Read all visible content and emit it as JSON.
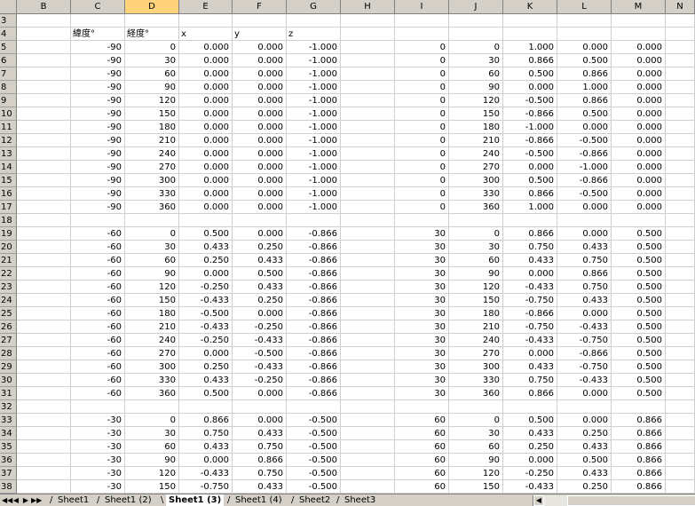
{
  "columns": [
    "B",
    "C",
    "D",
    "E",
    "F",
    "G",
    "H",
    "I",
    "J",
    "K",
    "L",
    "M",
    "N"
  ],
  "selected_column": "D",
  "header_row": {
    "row": "4",
    "c": "緯度°",
    "d": "経度°",
    "e": "x",
    "f": "y",
    "g": "z"
  },
  "rows": [
    {
      "r": "3"
    },
    {
      "r": "4",
      "hdr": true
    },
    {
      "r": "5",
      "c": "-90",
      "d": "0",
      "e": "0.000",
      "f": "0.000",
      "g": "-1.000",
      "i": "0",
      "j": "0",
      "k": "1.000",
      "l": "0.000",
      "m": "0.000"
    },
    {
      "r": "6",
      "c": "-90",
      "d": "30",
      "e": "0.000",
      "f": "0.000",
      "g": "-1.000",
      "i": "0",
      "j": "30",
      "k": "0.866",
      "l": "0.500",
      "m": "0.000"
    },
    {
      "r": "7",
      "c": "-90",
      "d": "60",
      "e": "0.000",
      "f": "0.000",
      "g": "-1.000",
      "i": "0",
      "j": "60",
      "k": "0.500",
      "l": "0.866",
      "m": "0.000"
    },
    {
      "r": "8",
      "c": "-90",
      "d": "90",
      "e": "0.000",
      "f": "0.000",
      "g": "-1.000",
      "i": "0",
      "j": "90",
      "k": "0.000",
      "l": "1.000",
      "m": "0.000"
    },
    {
      "r": "9",
      "c": "-90",
      "d": "120",
      "e": "0.000",
      "f": "0.000",
      "g": "-1.000",
      "i": "0",
      "j": "120",
      "k": "-0.500",
      "l": "0.866",
      "m": "0.000"
    },
    {
      "r": "10",
      "c": "-90",
      "d": "150",
      "e": "0.000",
      "f": "0.000",
      "g": "-1.000",
      "i": "0",
      "j": "150",
      "k": "-0.866",
      "l": "0.500",
      "m": "0.000"
    },
    {
      "r": "11",
      "c": "-90",
      "d": "180",
      "e": "0.000",
      "f": "0.000",
      "g": "-1.000",
      "i": "0",
      "j": "180",
      "k": "-1.000",
      "l": "0.000",
      "m": "0.000"
    },
    {
      "r": "12",
      "c": "-90",
      "d": "210",
      "e": "0.000",
      "f": "0.000",
      "g": "-1.000",
      "i": "0",
      "j": "210",
      "k": "-0.866",
      "l": "-0.500",
      "m": "0.000"
    },
    {
      "r": "13",
      "c": "-90",
      "d": "240",
      "e": "0.000",
      "f": "0.000",
      "g": "-1.000",
      "i": "0",
      "j": "240",
      "k": "-0.500",
      "l": "-0.866",
      "m": "0.000"
    },
    {
      "r": "14",
      "c": "-90",
      "d": "270",
      "e": "0.000",
      "f": "0.000",
      "g": "-1.000",
      "i": "0",
      "j": "270",
      "k": "0.000",
      "l": "-1.000",
      "m": "0.000"
    },
    {
      "r": "15",
      "c": "-90",
      "d": "300",
      "e": "0.000",
      "f": "0.000",
      "g": "-1.000",
      "i": "0",
      "j": "300",
      "k": "0.500",
      "l": "-0.866",
      "m": "0.000"
    },
    {
      "r": "16",
      "c": "-90",
      "d": "330",
      "e": "0.000",
      "f": "0.000",
      "g": "-1.000",
      "i": "0",
      "j": "330",
      "k": "0.866",
      "l": "-0.500",
      "m": "0.000"
    },
    {
      "r": "17",
      "c": "-90",
      "d": "360",
      "e": "0.000",
      "f": "0.000",
      "g": "-1.000",
      "i": "0",
      "j": "360",
      "k": "1.000",
      "l": "0.000",
      "m": "0.000"
    },
    {
      "r": "18"
    },
    {
      "r": "19",
      "c": "-60",
      "d": "0",
      "e": "0.500",
      "f": "0.000",
      "g": "-0.866",
      "i": "30",
      "j": "0",
      "k": "0.866",
      "l": "0.000",
      "m": "0.500"
    },
    {
      "r": "20",
      "c": "-60",
      "d": "30",
      "e": "0.433",
      "f": "0.250",
      "g": "-0.866",
      "i": "30",
      "j": "30",
      "k": "0.750",
      "l": "0.433",
      "m": "0.500"
    },
    {
      "r": "21",
      "c": "-60",
      "d": "60",
      "e": "0.250",
      "f": "0.433",
      "g": "-0.866",
      "i": "30",
      "j": "60",
      "k": "0.433",
      "l": "0.750",
      "m": "0.500"
    },
    {
      "r": "22",
      "c": "-60",
      "d": "90",
      "e": "0.000",
      "f": "0.500",
      "g": "-0.866",
      "i": "30",
      "j": "90",
      "k": "0.000",
      "l": "0.866",
      "m": "0.500"
    },
    {
      "r": "23",
      "c": "-60",
      "d": "120",
      "e": "-0.250",
      "f": "0.433",
      "g": "-0.866",
      "i": "30",
      "j": "120",
      "k": "-0.433",
      "l": "0.750",
      "m": "0.500"
    },
    {
      "r": "24",
      "c": "-60",
      "d": "150",
      "e": "-0.433",
      "f": "0.250",
      "g": "-0.866",
      "i": "30",
      "j": "150",
      "k": "-0.750",
      "l": "0.433",
      "m": "0.500"
    },
    {
      "r": "25",
      "c": "-60",
      "d": "180",
      "e": "-0.500",
      "f": "0.000",
      "g": "-0.866",
      "i": "30",
      "j": "180",
      "k": "-0.866",
      "l": "0.000",
      "m": "0.500"
    },
    {
      "r": "26",
      "c": "-60",
      "d": "210",
      "e": "-0.433",
      "f": "-0.250",
      "g": "-0.866",
      "i": "30",
      "j": "210",
      "k": "-0.750",
      "l": "-0.433",
      "m": "0.500"
    },
    {
      "r": "27",
      "c": "-60",
      "d": "240",
      "e": "-0.250",
      "f": "-0.433",
      "g": "-0.866",
      "i": "30",
      "j": "240",
      "k": "-0.433",
      "l": "-0.750",
      "m": "0.500"
    },
    {
      "r": "28",
      "c": "-60",
      "d": "270",
      "e": "0.000",
      "f": "-0.500",
      "g": "-0.866",
      "i": "30",
      "j": "270",
      "k": "0.000",
      "l": "-0.866",
      "m": "0.500"
    },
    {
      "r": "29",
      "c": "-60",
      "d": "300",
      "e": "0.250",
      "f": "-0.433",
      "g": "-0.866",
      "i": "30",
      "j": "300",
      "k": "0.433",
      "l": "-0.750",
      "m": "0.500"
    },
    {
      "r": "30",
      "c": "-60",
      "d": "330",
      "e": "0.433",
      "f": "-0.250",
      "g": "-0.866",
      "i": "30",
      "j": "330",
      "k": "0.750",
      "l": "-0.433",
      "m": "0.500"
    },
    {
      "r": "31",
      "c": "-60",
      "d": "360",
      "e": "0.500",
      "f": "0.000",
      "g": "-0.866",
      "i": "30",
      "j": "360",
      "k": "0.866",
      "l": "0.000",
      "m": "0.500"
    },
    {
      "r": "32"
    },
    {
      "r": "33",
      "c": "-30",
      "d": "0",
      "e": "0.866",
      "f": "0.000",
      "g": "-0.500",
      "i": "60",
      "j": "0",
      "k": "0.500",
      "l": "0.000",
      "m": "0.866"
    },
    {
      "r": "34",
      "c": "-30",
      "d": "30",
      "e": "0.750",
      "f": "0.433",
      "g": "-0.500",
      "i": "60",
      "j": "30",
      "k": "0.433",
      "l": "0.250",
      "m": "0.866"
    },
    {
      "r": "35",
      "c": "-30",
      "d": "60",
      "e": "0.433",
      "f": "0.750",
      "g": "-0.500",
      "i": "60",
      "j": "60",
      "k": "0.250",
      "l": "0.433",
      "m": "0.866"
    },
    {
      "r": "36",
      "c": "-30",
      "d": "90",
      "e": "0.000",
      "f": "0.866",
      "g": "-0.500",
      "i": "60",
      "j": "90",
      "k": "0.000",
      "l": "0.500",
      "m": "0.866"
    },
    {
      "r": "37",
      "c": "-30",
      "d": "120",
      "e": "-0.433",
      "f": "0.750",
      "g": "-0.500",
      "i": "60",
      "j": "120",
      "k": "-0.250",
      "l": "0.433",
      "m": "0.866"
    },
    {
      "r": "38",
      "c": "-30",
      "d": "150",
      "e": "-0.750",
      "f": "0.433",
      "g": "-0.500",
      "i": "60",
      "j": "150",
      "k": "-0.433",
      "l": "0.250",
      "m": "0.866"
    }
  ],
  "nav_buttons": [
    "◀◀",
    "◀",
    "▶",
    "▶▶"
  ],
  "sheet_tabs": [
    {
      "label": "Sheet1",
      "active": false
    },
    {
      "label": "Sheet1 (2)",
      "active": false
    },
    {
      "label": "Sheet1 (3)",
      "active": true
    },
    {
      "label": "Sheet1 (4)",
      "active": false
    },
    {
      "label": "Sheet2",
      "active": false
    },
    {
      "label": "Sheet3",
      "active": false
    }
  ],
  "hscroll_arrow": "◀"
}
